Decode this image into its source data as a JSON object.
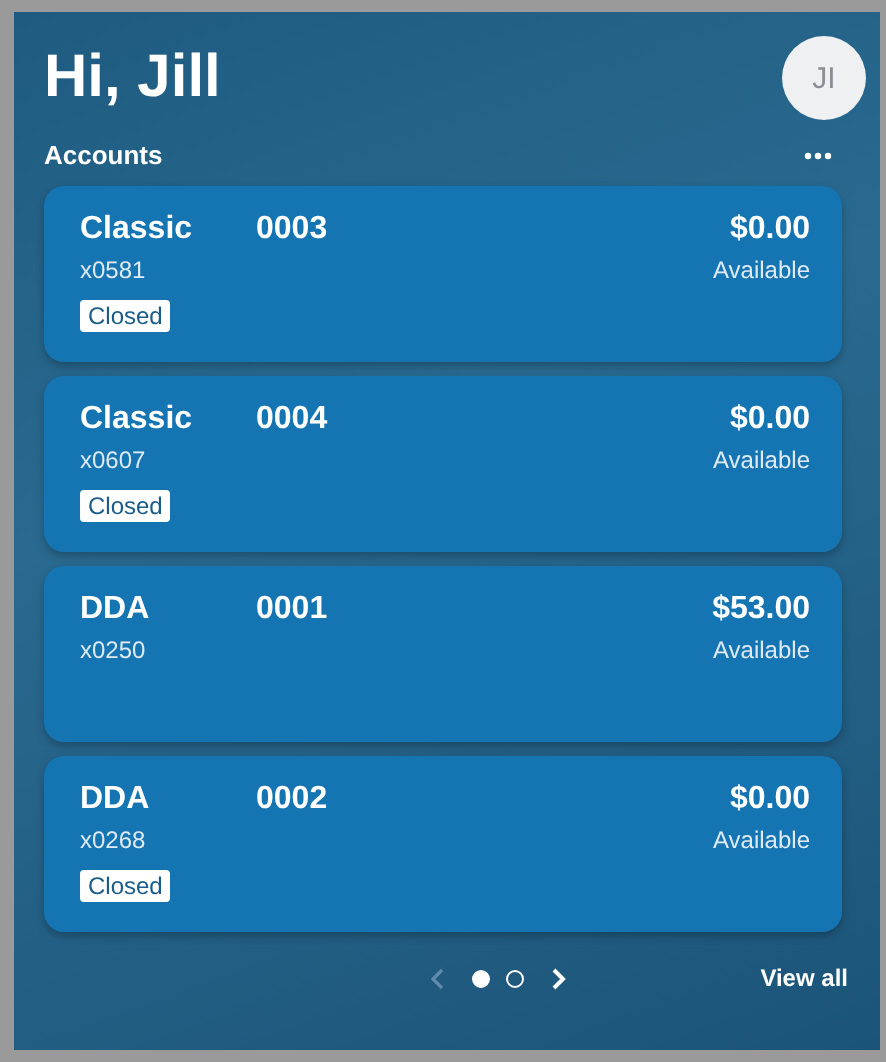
{
  "greeting": "Hi, Jill",
  "avatar": {
    "initials": "JI"
  },
  "section": {
    "title": "Accounts"
  },
  "accounts": [
    {
      "name": "Classic",
      "number": "0003",
      "masked": "x0581",
      "balance": "$0.00",
      "balance_label": "Available",
      "closed": true,
      "status": "Closed"
    },
    {
      "name": "Classic",
      "number": "0004",
      "masked": "x0607",
      "balance": "$0.00",
      "balance_label": "Available",
      "closed": true,
      "status": "Closed"
    },
    {
      "name": "DDA",
      "number": "0001",
      "masked": "x0250",
      "balance": "$53.00",
      "balance_label": "Available",
      "closed": false
    },
    {
      "name": "DDA",
      "number": "0002",
      "masked": "x0268",
      "balance": "$0.00",
      "balance_label": "Available",
      "closed": true,
      "status": "Closed"
    }
  ],
  "pager": {
    "prev_disabled": true,
    "next_disabled": false,
    "pages": [
      {
        "selected": true
      },
      {
        "selected": false
      }
    ]
  },
  "view_all": "View all"
}
